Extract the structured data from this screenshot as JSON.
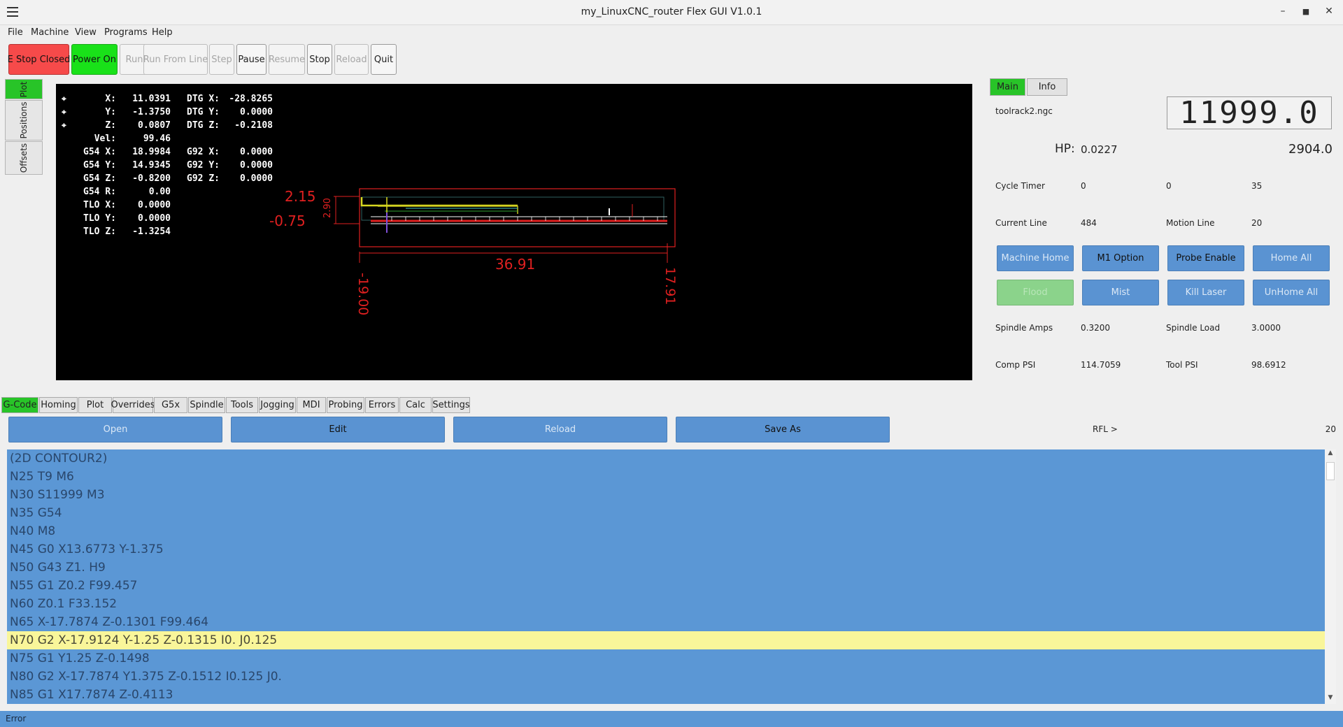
{
  "window": {
    "title": "my_LinuxCNC_router Flex GUI V1.0.1"
  },
  "menu": [
    "File",
    "Machine",
    "View",
    "Programs",
    "Help"
  ],
  "toolbar": {
    "estop": "E Stop Closed",
    "power": "Power On",
    "run": "Run",
    "run_from_line": "Run From Line",
    "step": "Step",
    "pause": "Pause",
    "resume": "Resume",
    "stop": "Stop",
    "reload": "Reload",
    "quit": "Quit"
  },
  "side_tabs": [
    "Plot",
    "Positions",
    "Offsets"
  ],
  "dro": {
    "rows": [
      [
        "X:",
        "11.0391",
        "DTG X:",
        "-28.8265"
      ],
      [
        "Y:",
        "-1.3750",
        "DTG Y:",
        "0.0000"
      ],
      [
        "Z:",
        "0.0807",
        "DTG Z:",
        "-0.2108"
      ],
      [
        "Vel:",
        "99.46",
        "",
        ""
      ],
      [
        "G54 X:",
        "18.9984",
        "G92 X:",
        "0.0000"
      ],
      [
        "G54 Y:",
        "14.9345",
        "G92 Y:",
        "0.0000"
      ],
      [
        "G54 Z:",
        "-0.8200",
        "G92 Z:",
        "0.0000"
      ],
      [
        "G54 R:",
        "0.00",
        "",
        ""
      ],
      [
        "TLO X:",
        "0.0000",
        "",
        ""
      ],
      [
        "TLO Y:",
        "0.0000",
        "",
        ""
      ],
      [
        "TLO Z:",
        "-1.3254",
        "",
        ""
      ]
    ]
  },
  "plot_dims": {
    "z_top": "2.15",
    "z_bottom": "-0.75",
    "z_height": "2.90",
    "width": "36.91",
    "x_min": "-19.00",
    "x_max": "17.91"
  },
  "right_panel": {
    "tabs": [
      "Main",
      "Info"
    ],
    "file_name": "toolrack2.ngc",
    "spindle_lcd": "11999.0",
    "hp_label": "HP:",
    "hp_value": "0.0227",
    "spindle_actual": "2904.0",
    "cycle_timer_label": "Cycle Timer",
    "cycle_timer": [
      "0",
      "0",
      "35"
    ],
    "current_line_label": "Current Line",
    "current_line": "484",
    "motion_line_label": "Motion Line",
    "motion_line": "20",
    "buttons_row1": [
      "Machine Home",
      "M1 Option",
      "Probe Enable",
      "Home All"
    ],
    "buttons_row2": [
      "Flood",
      "Mist",
      "Kill Laser",
      "UnHome All"
    ],
    "spindle_amps_label": "Spindle Amps",
    "spindle_amps": "0.3200",
    "spindle_load_label": "Spindle Load",
    "spindle_load": "3.0000",
    "comp_psi_label": "Comp PSI",
    "comp_psi": "114.7059",
    "tool_psi_label": "Tool PSI",
    "tool_psi": "98.6912"
  },
  "bottom_tabs": [
    "G-Code",
    "Homing",
    "Plot",
    "Overrides",
    "G5x",
    "Spindle",
    "Tools",
    "Jogging",
    "MDI",
    "Probing",
    "Errors",
    "Calc",
    "Settings"
  ],
  "gcode_actions": {
    "open": "Open",
    "edit": "Edit",
    "reload": "Reload",
    "save_as": "Save As",
    "rfl": "RFL >",
    "rfl_line": "20"
  },
  "gcode_lines": [
    "(2D CONTOUR2)",
    "N25 T9 M6",
    "N30 S11999 M3",
    "N35 G54",
    "N40 M8",
    "N45 G0 X13.6773 Y-1.375",
    "N50 G43 Z1. H9",
    "N55 G1 Z0.2 F99.457",
    "N60 Z0.1 F33.152",
    "N65 X-17.7874 Z-0.1301 F99.464",
    "N70 G2 X-17.9124 Y-1.25 Z-0.1315 I0. J0.125",
    "N75 G1 Y1.25 Z-0.1498",
    "N80 G2 X-17.7874 Y1.375 Z-0.1512 I0.125 J0.",
    "N85 G1 X17.7874 Z-0.4113"
  ],
  "gcode_highlight_index": 10,
  "status_bar": "Error",
  "colors": {
    "estop": "#f64a4a",
    "power_on": "#19e119",
    "active_tab": "#28c428",
    "button_blue": "#5a93d2",
    "highlight_line": "#f9f69a",
    "plot_red": "#e02020"
  }
}
